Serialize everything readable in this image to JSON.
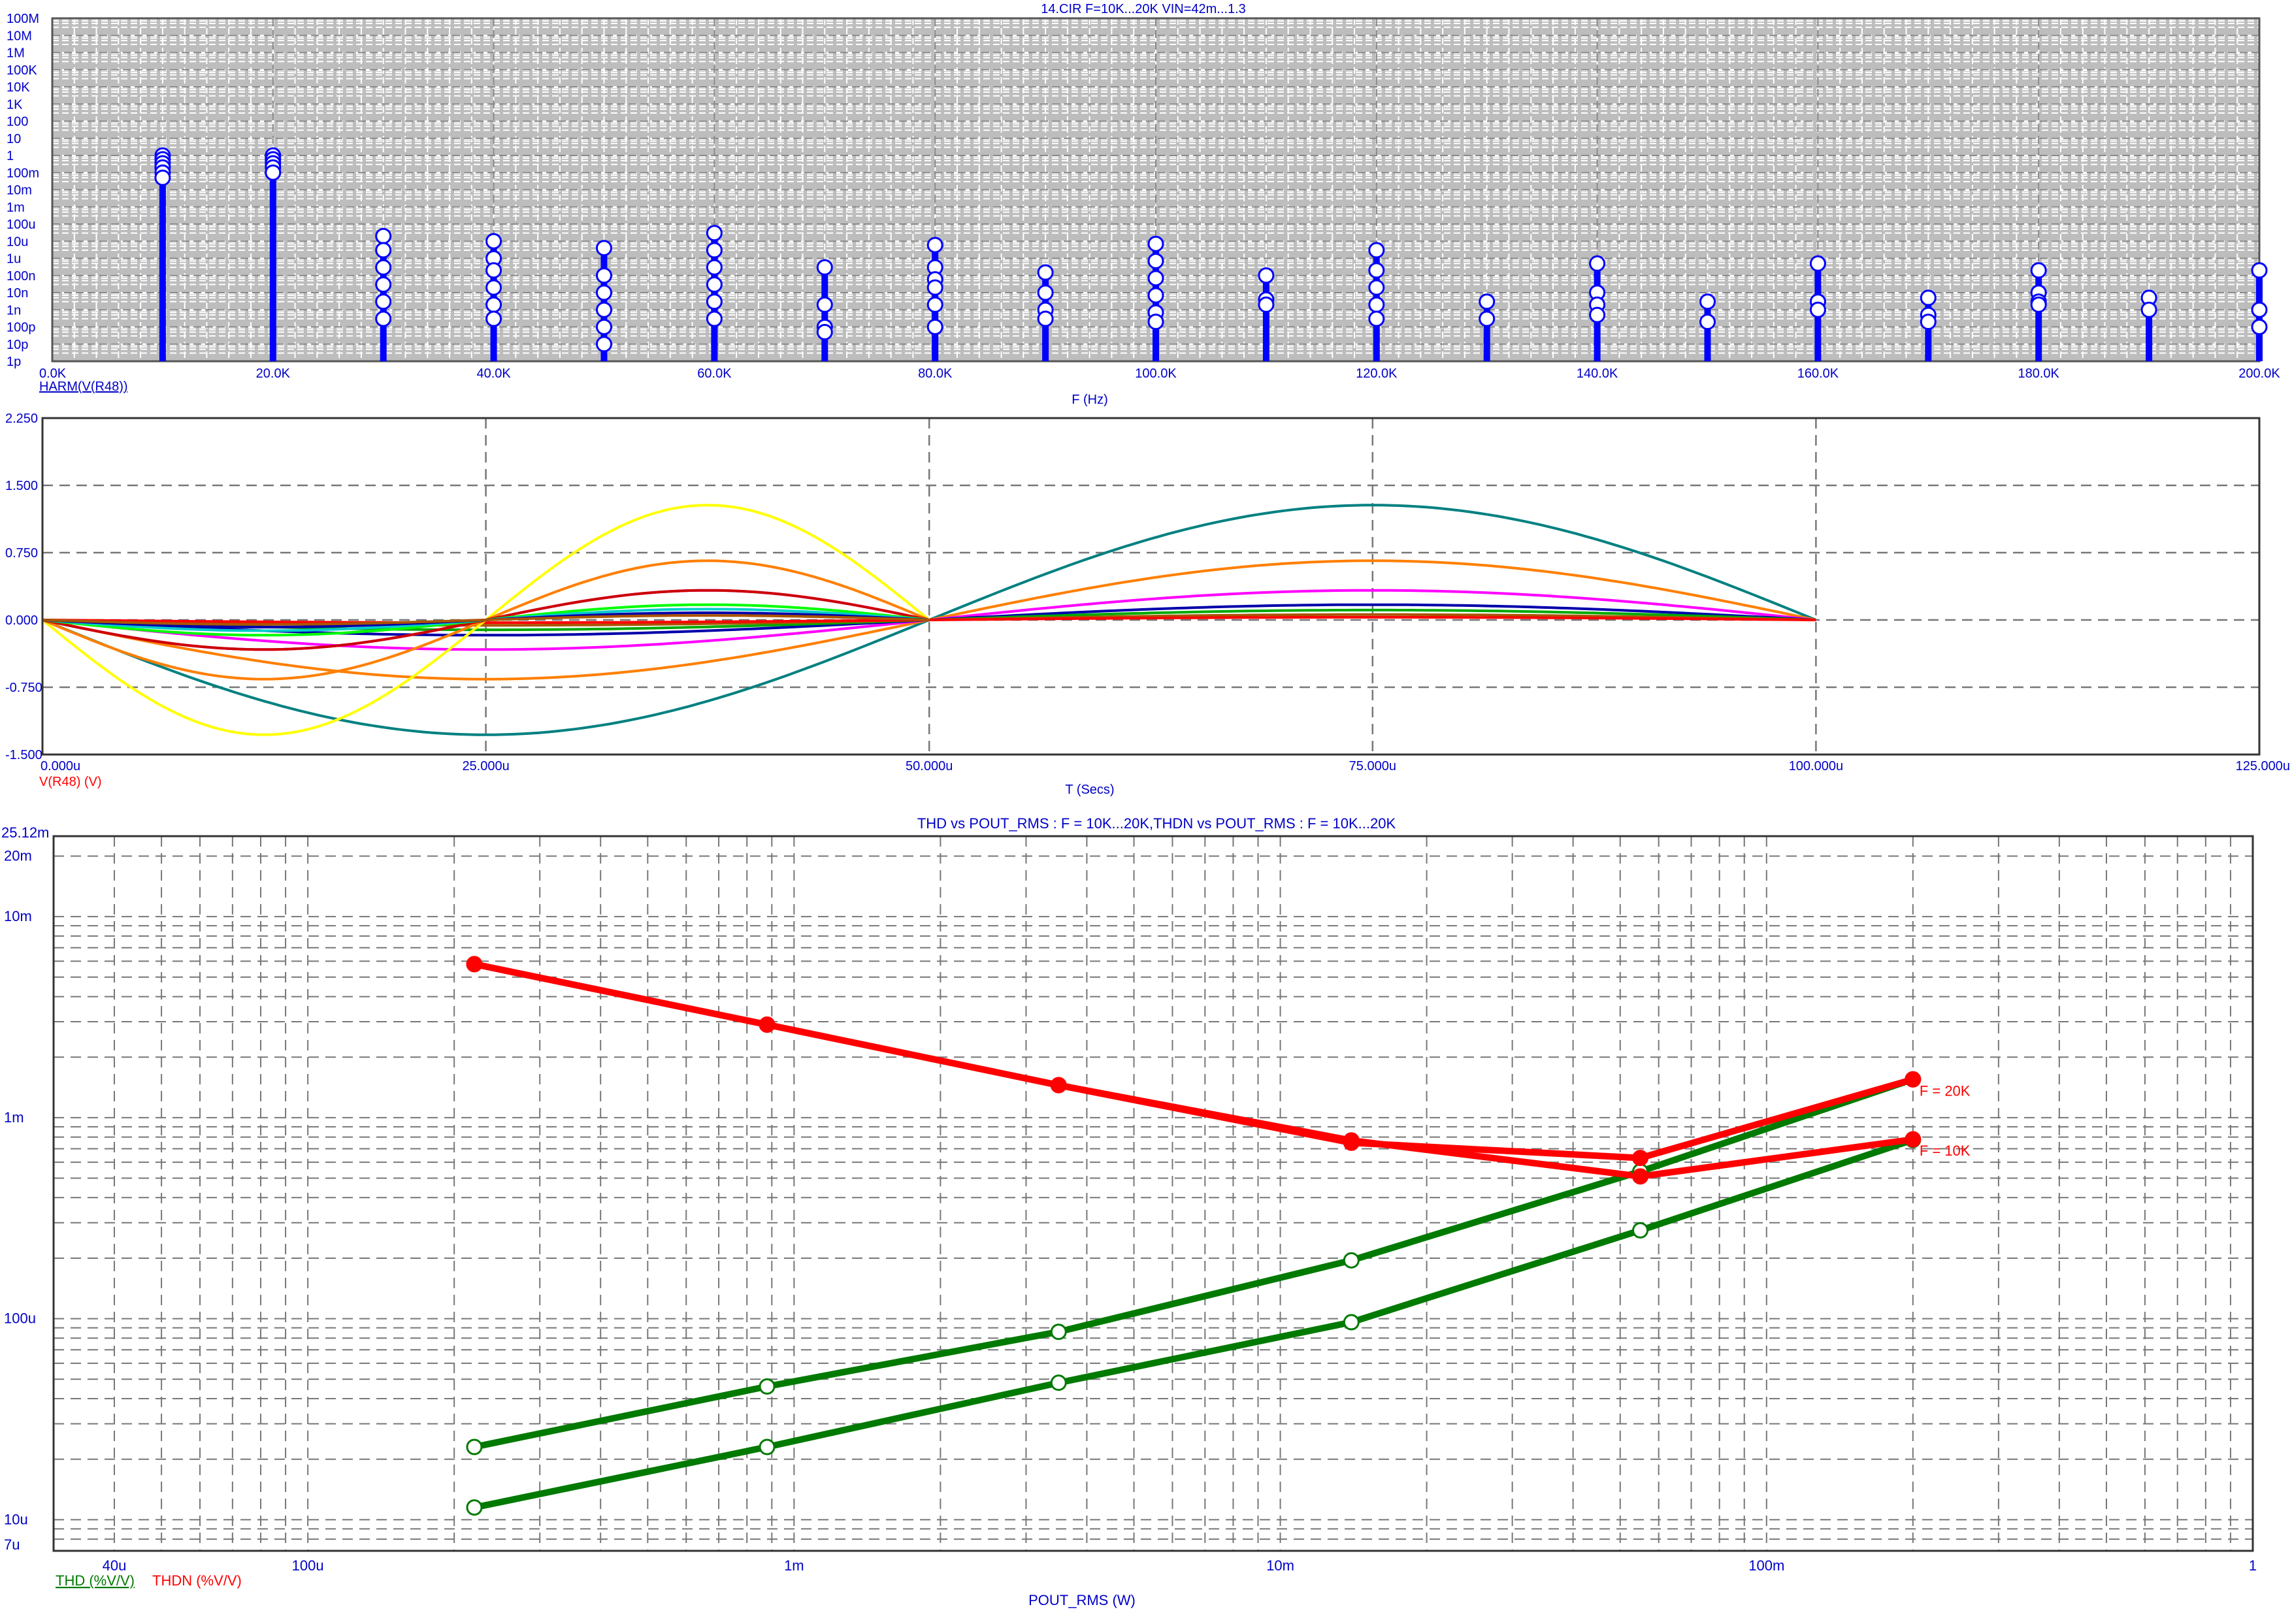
{
  "colors": {
    "axis_text": "#0000c8",
    "harm_stem": "#0000ff",
    "harm_grid_bg": "#bdbdbd",
    "thd": "#007a00",
    "thdn": "#ff0000",
    "grid": "#777777"
  },
  "chart_data": [
    {
      "type": "bar",
      "title": "14.CIR F=10K...20K VIN=42m...1.3",
      "xlabel": "F (Hz)",
      "series_label": "HARM(V(R48))",
      "xlim": [
        0,
        200000
      ],
      "ylim": [
        1e-12,
        100000000.0
      ],
      "yscale": "log",
      "xticks": [
        0,
        20000,
        40000,
        60000,
        80000,
        100000,
        120000,
        140000,
        160000,
        180000,
        200000
      ],
      "xtick_labels": [
        "0.0K",
        "20.0K",
        "40.0K",
        "60.0K",
        "80.0K",
        "100.0K",
        "120.0K",
        "140.0K",
        "160.0K",
        "180.0K",
        "200.0K"
      ],
      "yticks": [
        100000000.0,
        10000000.0,
        1000000.0,
        100000.0,
        10000.0,
        1000.0,
        100,
        10,
        1,
        0.1,
        0.01,
        0.001,
        0.0001,
        1e-05,
        1e-06,
        1e-07,
        1e-08,
        1e-09,
        1e-10,
        1e-11,
        1e-12
      ],
      "ytick_labels": [
        "100M",
        "10M",
        "1M",
        "100K",
        "10K",
        "1K",
        "100",
        "10",
        "1",
        "100m",
        "10m",
        "1m",
        "100u",
        "10u",
        "1u",
        "100n",
        "10n",
        "1n",
        "100p",
        "10p",
        "1p"
      ],
      "harmonics": [
        {
          "f": 10000,
          "values": [
            1.0,
            0.6,
            0.35,
            0.2,
            0.1,
            0.05
          ]
        },
        {
          "f": 20000,
          "values": [
            1.0,
            0.6,
            0.35,
            0.2,
            0.1
          ]
        },
        {
          "f": 30000,
          "values": [
            2e-05,
            3e-06,
            3e-07,
            3e-08,
            3e-09,
            3e-10
          ]
        },
        {
          "f": 40000,
          "values": [
            1e-05,
            1e-06,
            2e-07,
            2e-08,
            2e-09,
            3e-10
          ]
        },
        {
          "f": 50000,
          "values": [
            4e-06,
            1e-07,
            1e-08,
            1e-09,
            1e-10,
            1e-11
          ]
        },
        {
          "f": 60000,
          "values": [
            3e-05,
            3e-06,
            3e-07,
            3e-08,
            3e-09,
            3e-10
          ]
        },
        {
          "f": 70000,
          "values": [
            3e-07,
            2e-09,
            1e-10,
            5e-11
          ]
        },
        {
          "f": 80000,
          "values": [
            6e-06,
            3e-07,
            6e-08,
            2e-08,
            2e-09,
            1e-10
          ]
        },
        {
          "f": 90000,
          "values": [
            1.5e-07,
            1e-08,
            1e-09,
            3e-10
          ]
        },
        {
          "f": 100000,
          "values": [
            7e-06,
            7e-07,
            7e-08,
            7e-09,
            7e-10,
            2e-10
          ]
        },
        {
          "f": 110000,
          "values": [
            1e-07,
            4e-09,
            2e-09
          ]
        },
        {
          "f": 120000,
          "values": [
            3e-06,
            2e-07,
            2e-08,
            2e-09,
            3e-10
          ]
        },
        {
          "f": 130000,
          "values": [
            3e-09,
            3e-10
          ]
        },
        {
          "f": 140000,
          "values": [
            5e-07,
            1e-08,
            2e-09,
            5e-10
          ]
        },
        {
          "f": 150000,
          "values": [
            3e-09,
            2e-10
          ]
        },
        {
          "f": 160000,
          "values": [
            5e-07,
            3e-09,
            1e-09
          ]
        },
        {
          "f": 170000,
          "values": [
            5e-09,
            5e-10,
            2e-10
          ]
        },
        {
          "f": 180000,
          "values": [
            2e-07,
            1e-08,
            3e-09,
            2e-09
          ]
        },
        {
          "f": 190000,
          "values": [
            5e-09,
            1e-09
          ]
        },
        {
          "f": 200000,
          "values": [
            2e-07,
            1e-09,
            1e-10
          ]
        }
      ]
    },
    {
      "type": "line",
      "xlabel": "T (Secs)",
      "series_label": "V(R48) (V)",
      "xlim": [
        0,
        125
      ],
      "x_unit": "us",
      "ylim": [
        -1.5,
        2.25
      ],
      "xticks": [
        0,
        25,
        50,
        75,
        100,
        125
      ],
      "xtick_labels": [
        "0.000u",
        "25.000u",
        "50.000u",
        "75.000u",
        "100.000u",
        "125.000u"
      ],
      "yticks": [
        2.25,
        1.5,
        0.75,
        0.0,
        -0.75,
        -1.5
      ],
      "ytick_labels": [
        "2.250",
        "1.500",
        "0.750",
        "0.000",
        "-0.750",
        "-1.500"
      ],
      "series": [
        {
          "color": "#008080",
          "frequency": "10K",
          "amplitude": 1.28
        },
        {
          "color": "#ff7f00",
          "frequency": "10K",
          "amplitude": 0.66
        },
        {
          "color": "#ff00ff",
          "frequency": "10K",
          "amplitude": 0.33
        },
        {
          "color": "#0000aa",
          "frequency": "10K",
          "amplitude": 0.17
        },
        {
          "color": "#00aa00",
          "frequency": "10K",
          "amplitude": 0.11
        },
        {
          "color": "#aa5500",
          "frequency": "10K",
          "amplitude": 0.06
        },
        {
          "color": "#ff0000",
          "frequency": "10K",
          "amplitude": 0.03
        },
        {
          "color": "#ffff00",
          "frequency": "20K",
          "amplitude": 1.28
        },
        {
          "color": "#ff7f00",
          "frequency": "20K",
          "amplitude": 0.66
        },
        {
          "color": "#ff00ff",
          "frequency": "20K",
          "amplitude": 0.33
        },
        {
          "color": "#cc0000",
          "frequency": "20K",
          "amplitude": 0.33
        },
        {
          "color": "#00ff00",
          "frequency": "20K",
          "amplitude": 0.17
        },
        {
          "color": "#00cccc",
          "frequency": "20K",
          "amplitude": 0.12
        },
        {
          "color": "#0000aa",
          "frequency": "20K",
          "amplitude": 0.08
        },
        {
          "color": "#aa5500",
          "frequency": "20K",
          "amplitude": 0.05
        }
      ]
    },
    {
      "type": "line",
      "title": "THD vs POUT_RMS : F = 10K...20K,THDN vs POUT_RMS : F = 10K...20K",
      "xlabel": "POUT_RMS (W)",
      "xscale": "log",
      "yscale": "log",
      "xlim": [
        3e-05,
        1
      ],
      "ylim": [
        7e-06,
        0.02512
      ],
      "xticks": [
        4e-05,
        0.0001,
        0.001,
        0.01,
        0.1,
        1
      ],
      "xtick_labels": [
        "40u",
        "100u",
        "1m",
        "10m",
        "100m",
        "1"
      ],
      "yticks": [
        0.02512,
        0.02,
        0.01,
        0.001,
        0.0001,
        1e-05,
        7e-06
      ],
      "ytick_labels": [
        "25.12m",
        "20m",
        "10m",
        "1m",
        "100u",
        "10u",
        "7u"
      ],
      "legend": [
        "THD (%V/V)",
        "THDN (%V/V)"
      ],
      "series": [
        {
          "name": "THD (%V/V)",
          "color": "#007a00",
          "marker": "open-circle",
          "x": [
            0.00022,
            0.00088,
            0.0035,
            0.014,
            0.055,
            0.2
          ],
          "y": [
            2.3e-05,
            4.6e-05,
            8.6e-05,
            0.000195,
            0.00054,
            0.00155
          ]
        },
        {
          "name": "THD (%V/V)",
          "color": "#007a00",
          "marker": "open-circle",
          "x": [
            0.00022,
            0.00088,
            0.0035,
            0.014,
            0.055,
            0.2
          ],
          "y": [
            1.15e-05,
            2.3e-05,
            4.8e-05,
            9.6e-05,
            0.000275,
            0.000775
          ]
        },
        {
          "name": "THDN (%V/V)",
          "color": "#ff0000",
          "marker": "filled-circle",
          "label": "F = 20K",
          "x": [
            0.00022,
            0.00088,
            0.0035,
            0.014,
            0.055,
            0.2
          ],
          "y": [
            0.0058,
            0.0029,
            0.00145,
            0.00075,
            0.00063,
            0.00155
          ]
        },
        {
          "name": "THDN (%V/V)",
          "color": "#ff0000",
          "marker": "filled-circle",
          "label": "F = 10K",
          "x": [
            0.00022,
            0.00088,
            0.0035,
            0.014,
            0.055,
            0.2
          ],
          "y": [
            0.0058,
            0.0029,
            0.00145,
            0.00077,
            0.00051,
            0.00078
          ]
        }
      ]
    }
  ]
}
